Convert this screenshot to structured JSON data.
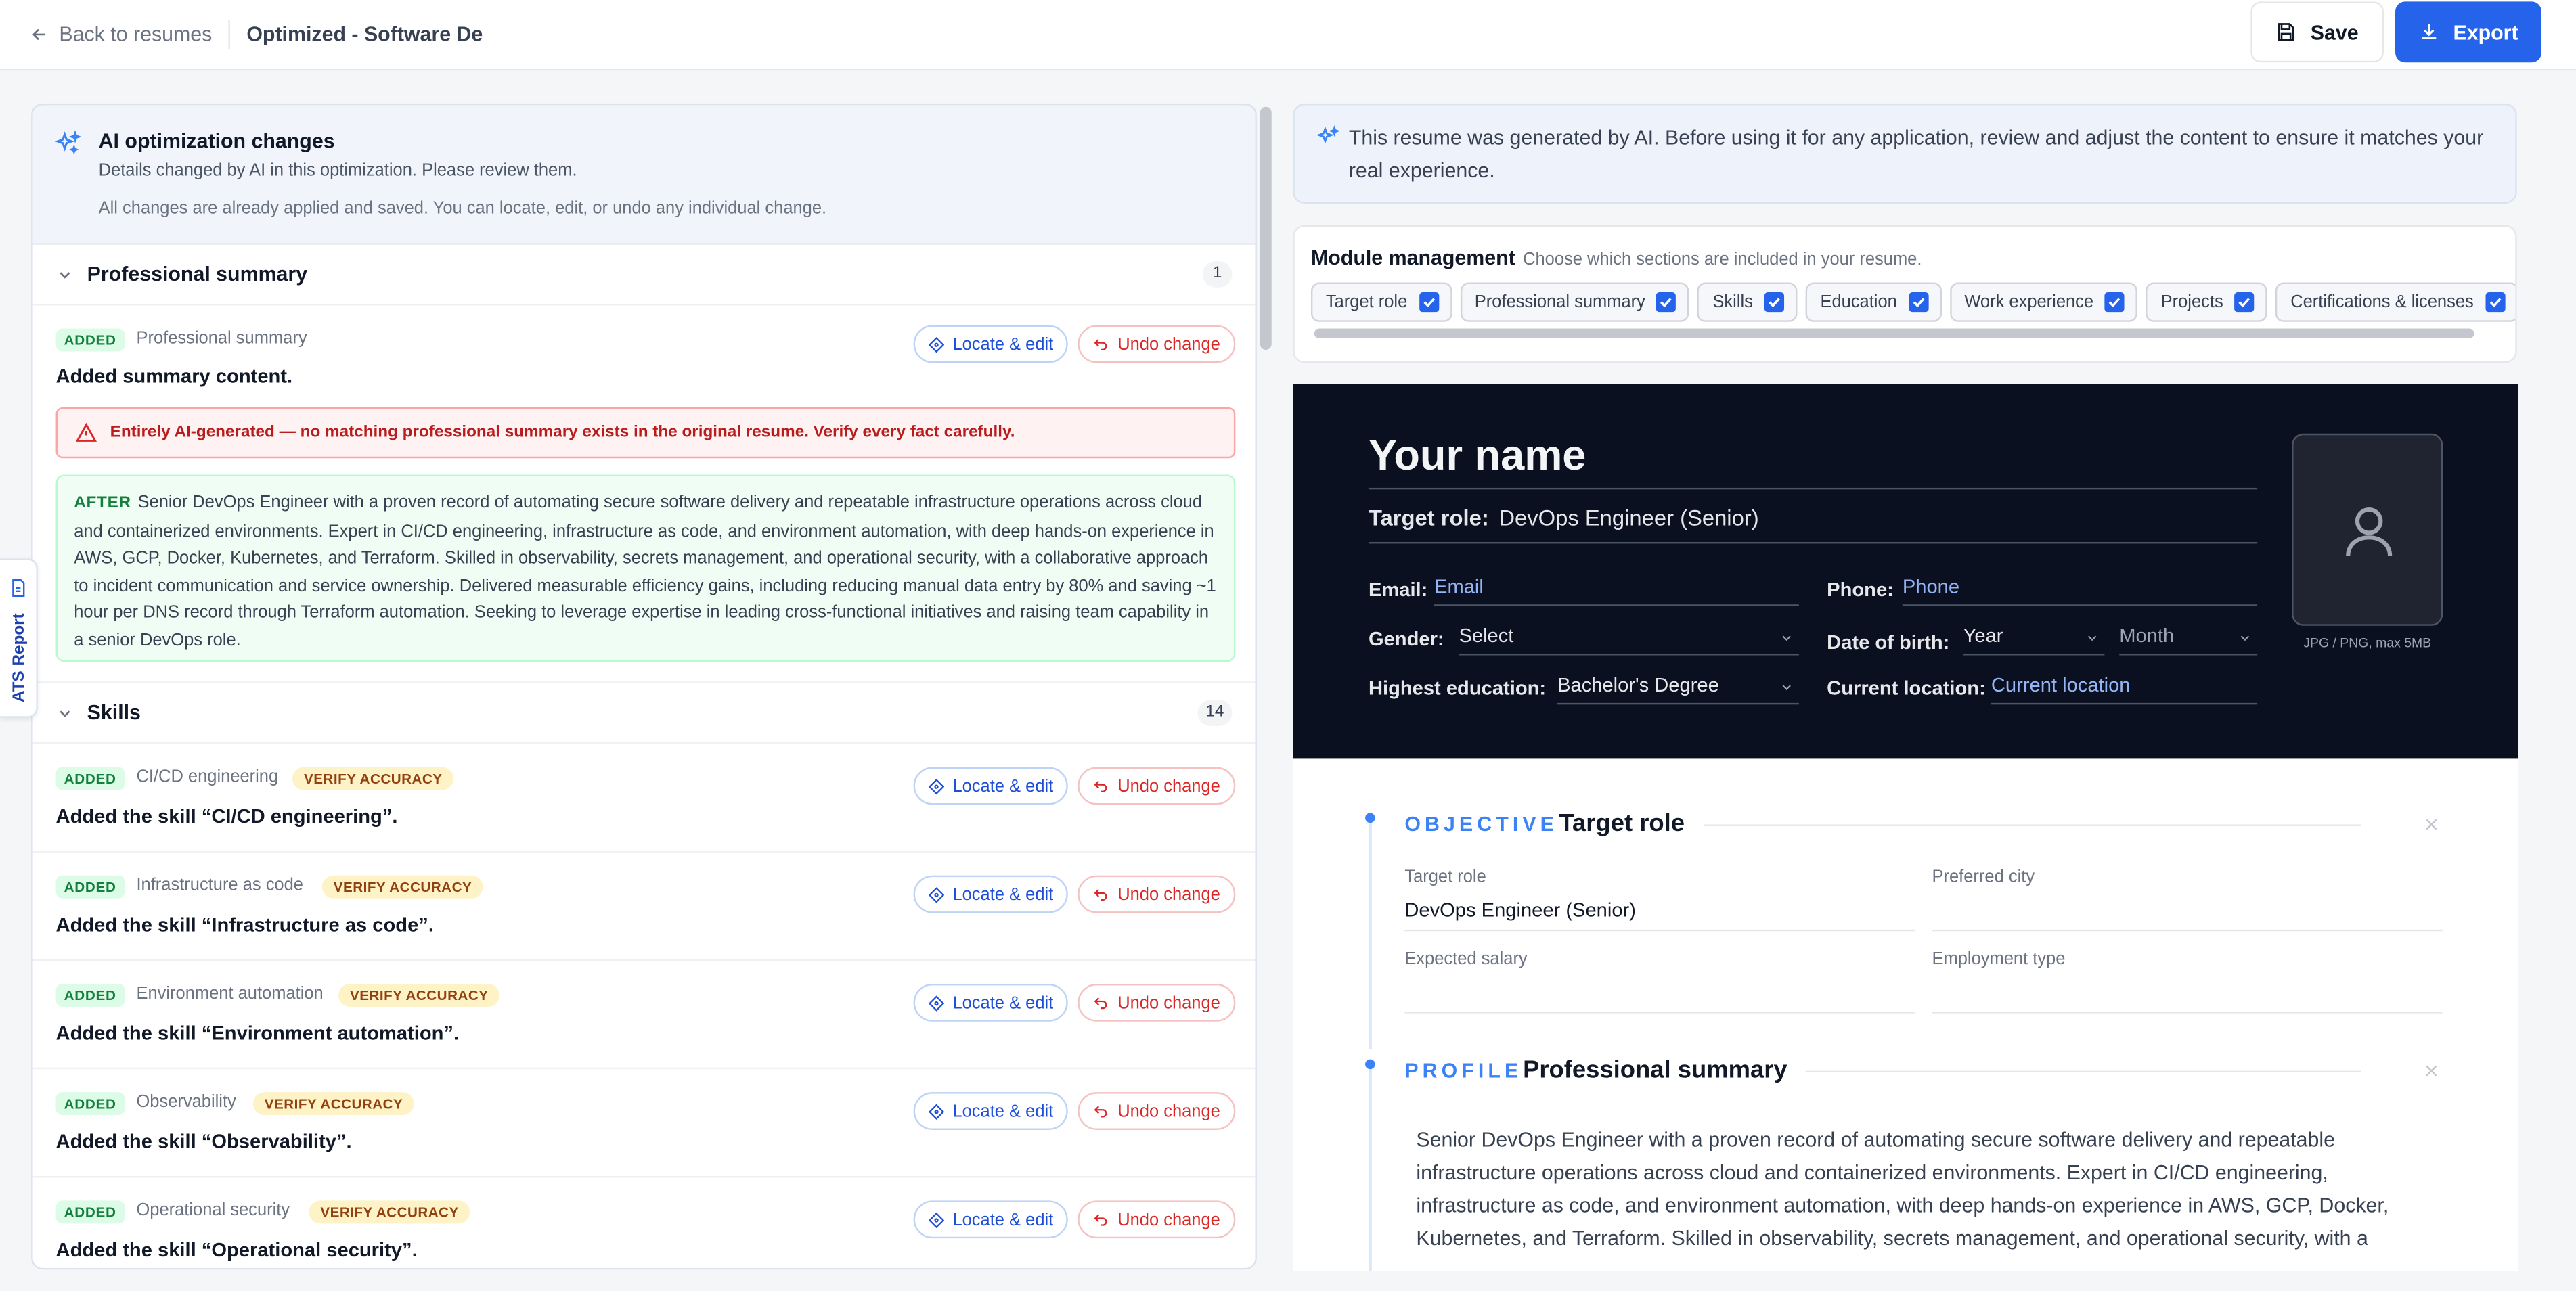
{
  "header": {
    "back_label": "Back to resumes",
    "doc_title": "Optimized - Software De",
    "save_label": "Save",
    "export_label": "Export"
  },
  "ai_panel": {
    "title": "AI optimization changes",
    "subtitle": "Details changed by AI in this optimization. Please review them.",
    "note": "All changes are already applied and saved. You can locate, edit, or undo any individual change.",
    "sections": [
      {
        "title": "Professional summary",
        "count": "1",
        "item": {
          "badge": "ADDED",
          "label": "Professional summary",
          "main": "Added summary content.",
          "warning": "Entirely AI-generated — no matching professional summary exists in the original resume. Verify every fact carefully.",
          "after_label": "AFTER",
          "after_text": "Senior DevOps Engineer with a proven record of automating secure software delivery and repeatable infrastructure operations across cloud and containerized environments. Expert in CI/CD engineering, infrastructure as code, and environment automation, with deep hands-on experience in AWS, GCP, Docker, Kubernetes, and Terraform. Skilled in observability, secrets management, and operational security, with a collaborative approach to incident communication and service ownership. Delivered measurable efficiency gains, including reducing manual data entry by 80% and saving ~1 hour per DNS record through Terraform automation. Seeking to leverage expertise in leading cross-functional initiatives and raising team capability in a senior DevOps role."
        }
      },
      {
        "title": "Skills",
        "count": "14",
        "items": [
          {
            "badge": "ADDED",
            "label": "CI/CD engineering",
            "verify": "VERIFY ACCURACY",
            "main": "Added the skill “CI/CD engineering”."
          },
          {
            "badge": "ADDED",
            "label": "Infrastructure as code",
            "verify": "VERIFY ACCURACY",
            "main": "Added the skill “Infrastructure as code”."
          },
          {
            "badge": "ADDED",
            "label": "Environment automation",
            "verify": "VERIFY ACCURACY",
            "main": "Added the skill “Environment automation”."
          },
          {
            "badge": "ADDED",
            "label": "Observability",
            "verify": "VERIFY ACCURACY",
            "main": "Added the skill “Observability”."
          },
          {
            "badge": "ADDED",
            "label": "Operational security",
            "verify": "VERIFY ACCURACY",
            "main": "Added the skill “Operational security”."
          }
        ]
      }
    ],
    "locate_label": "Locate & edit",
    "undo_label": "Undo change"
  },
  "ats_tab": {
    "label": "ATS Report"
  },
  "notice": {
    "text": "This resume was generated by AI. Before using it for any application, review and adjust the content to ensure it matches your real experience."
  },
  "modules": {
    "title": "Module management",
    "subtitle": "Choose which sections are included in your resume.",
    "chips": [
      {
        "label": "Target role",
        "checked": true
      },
      {
        "label": "Professional summary",
        "checked": true
      },
      {
        "label": "Skills",
        "checked": true
      },
      {
        "label": "Education",
        "checked": true
      },
      {
        "label": "Work experience",
        "checked": true
      },
      {
        "label": "Projects",
        "checked": true
      },
      {
        "label": "Certifications & licenses",
        "checked": true
      }
    ]
  },
  "resume": {
    "name": "Your name",
    "target_role_key": "Target role:",
    "target_role_value": "DevOps Engineer (Senior)",
    "email_key": "Email:",
    "email_placeholder": "Email",
    "phone_key": "Phone:",
    "phone_placeholder": "Phone",
    "gender_key": "Gender:",
    "gender_value": "Select",
    "dob_key": "Date of birth:",
    "dob_year": "Year",
    "dob_month": "Month",
    "education_key": "Highest education:",
    "education_value": "Bachelor's Degree",
    "location_key": "Current location:",
    "location_placeholder": "Current location",
    "photo_caption": "JPG / PNG, max 5MB",
    "objective": {
      "kicker": "OBJECTIVE",
      "title": "Target role",
      "target_role_label": "Target role",
      "target_role_value": "DevOps Engineer (Senior)",
      "preferred_city_label": "Preferred city",
      "preferred_city_value": "",
      "expected_salary_label": "Expected salary",
      "expected_salary_value": "",
      "employment_type_label": "Employment type",
      "employment_type_value": ""
    },
    "profile": {
      "kicker": "PROFILE",
      "title": "Professional summary",
      "text": "Senior DevOps Engineer with a proven record of automating secure software delivery and repeatable infrastructure operations across cloud and containerized environments. Expert in CI/CD engineering, infrastructure as code, and environment automation, with deep hands-on experience in AWS, GCP, Docker, Kubernetes, and Terraform. Skilled in observability, secrets management, and operational security, with a"
    }
  },
  "colors": {
    "accent": "#2563eb",
    "added_badge": "#dcfce7",
    "verify_badge": "#fef3c7",
    "undo_red": "#dc2626",
    "resume_header_bg": "#0b1020"
  },
  "icons": [
    "arrow-left-icon",
    "save-icon",
    "download-icon",
    "sparkles-icon",
    "chevron-down-icon",
    "alert-triangle-icon",
    "locate-icon",
    "undo-icon",
    "report-icon",
    "checkbox-icon",
    "user-icon",
    "close-icon"
  ]
}
